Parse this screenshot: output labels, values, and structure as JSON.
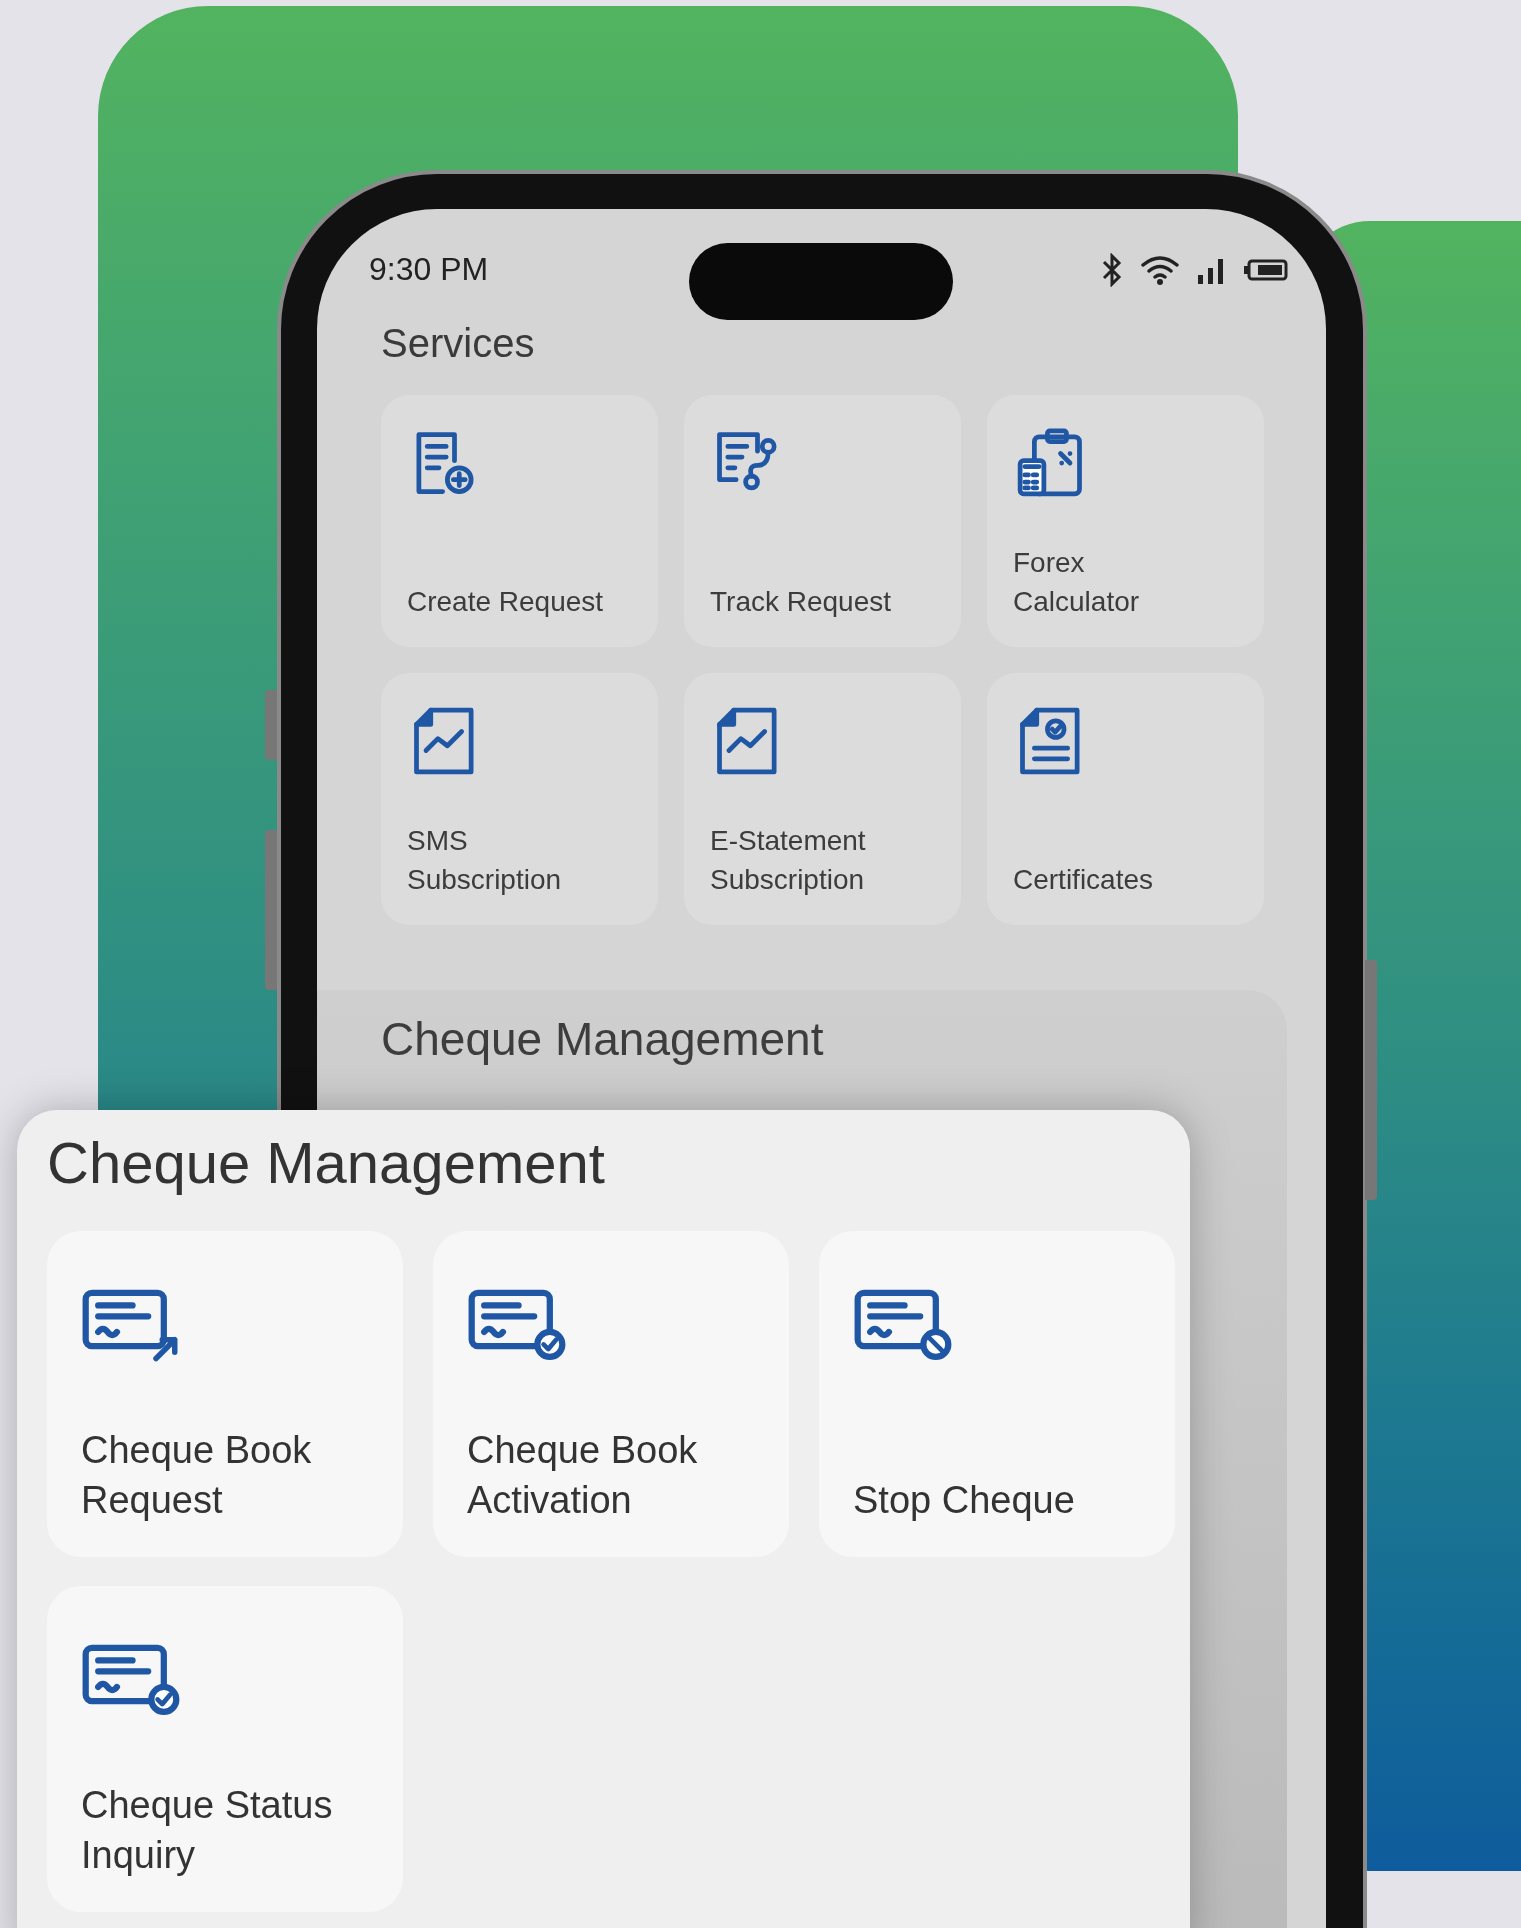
{
  "status_bar": {
    "time": "9:30 PM"
  },
  "services": {
    "title": "Services",
    "tiles": [
      {
        "lines": [
          "Create Request"
        ],
        "kind": "doc-plus"
      },
      {
        "lines": [
          "Track Request"
        ],
        "kind": "doc-route"
      },
      {
        "lines": [
          "Forex",
          "Calculator"
        ],
        "kind": "calculator"
      },
      {
        "lines": [
          "SMS",
          "Subscription"
        ],
        "kind": "chart-doc"
      },
      {
        "lines": [
          "E-Statement",
          "Subscription"
        ],
        "kind": "chart-doc"
      },
      {
        "lines": [
          "Certificates"
        ],
        "kind": "certificate"
      }
    ]
  },
  "cheque_management_behind": {
    "title": "Cheque Management"
  },
  "cheque_management": {
    "title": "Cheque Management",
    "tiles": [
      {
        "lines": [
          "Cheque Book",
          "Request"
        ],
        "kind": "cheque-arrow"
      },
      {
        "lines": [
          "Cheque Book",
          "Activation"
        ],
        "kind": "cheque-check"
      },
      {
        "lines": [
          "Stop Cheque"
        ],
        "kind": "cheque-stop"
      },
      {
        "lines": [
          "Cheque Status",
          "Inquiry"
        ],
        "kind": "cheque-check"
      }
    ]
  }
}
